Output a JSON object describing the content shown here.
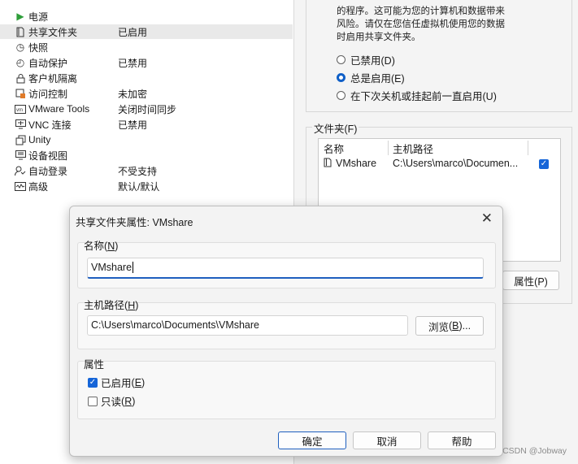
{
  "settings": {
    "items": [
      {
        "icon": "power-icon",
        "name": "电源",
        "value": ""
      },
      {
        "icon": "shared-folder-icon",
        "name": "共享文件夹",
        "value": "已启用"
      },
      {
        "icon": "snapshot-icon",
        "name": "快照",
        "value": ""
      },
      {
        "icon": "autoprotect-icon",
        "name": "自动保护",
        "value": "已禁用"
      },
      {
        "icon": "lock-icon",
        "name": "客户机隔离",
        "value": ""
      },
      {
        "icon": "access-control-icon",
        "name": "访问控制",
        "value": "未加密"
      },
      {
        "icon": "vmware-tools-icon",
        "name": "VMware Tools",
        "value": "关闭时间同步"
      },
      {
        "icon": "vnc-icon",
        "name": "VNC 连接",
        "value": "已禁用"
      },
      {
        "icon": "unity-icon",
        "name": "Unity",
        "value": ""
      },
      {
        "icon": "device-view-icon",
        "name": "设备视图",
        "value": ""
      },
      {
        "icon": "autologin-icon",
        "name": "自动登录",
        "value": "不受支持"
      },
      {
        "icon": "advanced-icon",
        "name": "高级",
        "value": "默认/默认"
      }
    ]
  },
  "right": {
    "desc_lines": [
      "的程序。这可能为您的计算机和数据带来",
      "风险。请仅在您信任虚拟机使用您的数据",
      "时启用共享文件夹。"
    ],
    "radios": [
      {
        "label": "已禁用(D)",
        "checked": false
      },
      {
        "label": "总是启用(E)",
        "checked": true
      },
      {
        "label": "在下次关机或挂起前一直启用(U)",
        "checked": false
      }
    ],
    "folders_label": "文件夹(F)",
    "table": {
      "headers": [
        "名称",
        "主机路径"
      ],
      "row": {
        "name": "VMshare",
        "path": "C:\\Users\\marco\\Documen..."
      }
    },
    "properties_button": "属性(P)"
  },
  "dialog": {
    "title": "共享文件夹属性: VMshare",
    "close": "✕",
    "name_label": "名称",
    "name_key": "N",
    "name_value": "VMshare",
    "path_label": "主机路径",
    "path_key": "H",
    "path_value": "C:\\Users\\marco\\Documents\\VMshare",
    "browse_label": "浏览",
    "browse_key": "B",
    "attributes_label": "属性",
    "enabled_label": "已启用",
    "enabled_key": "E",
    "enabled_checked": true,
    "readonly_label": "只读",
    "readonly_key": "R",
    "readonly_checked": false,
    "ok": "确定",
    "cancel": "取消",
    "help": "帮助"
  },
  "watermark": "CSDN @Jobway",
  "colors": {
    "accent": "#1565d8",
    "power": "#2e9e3a"
  }
}
